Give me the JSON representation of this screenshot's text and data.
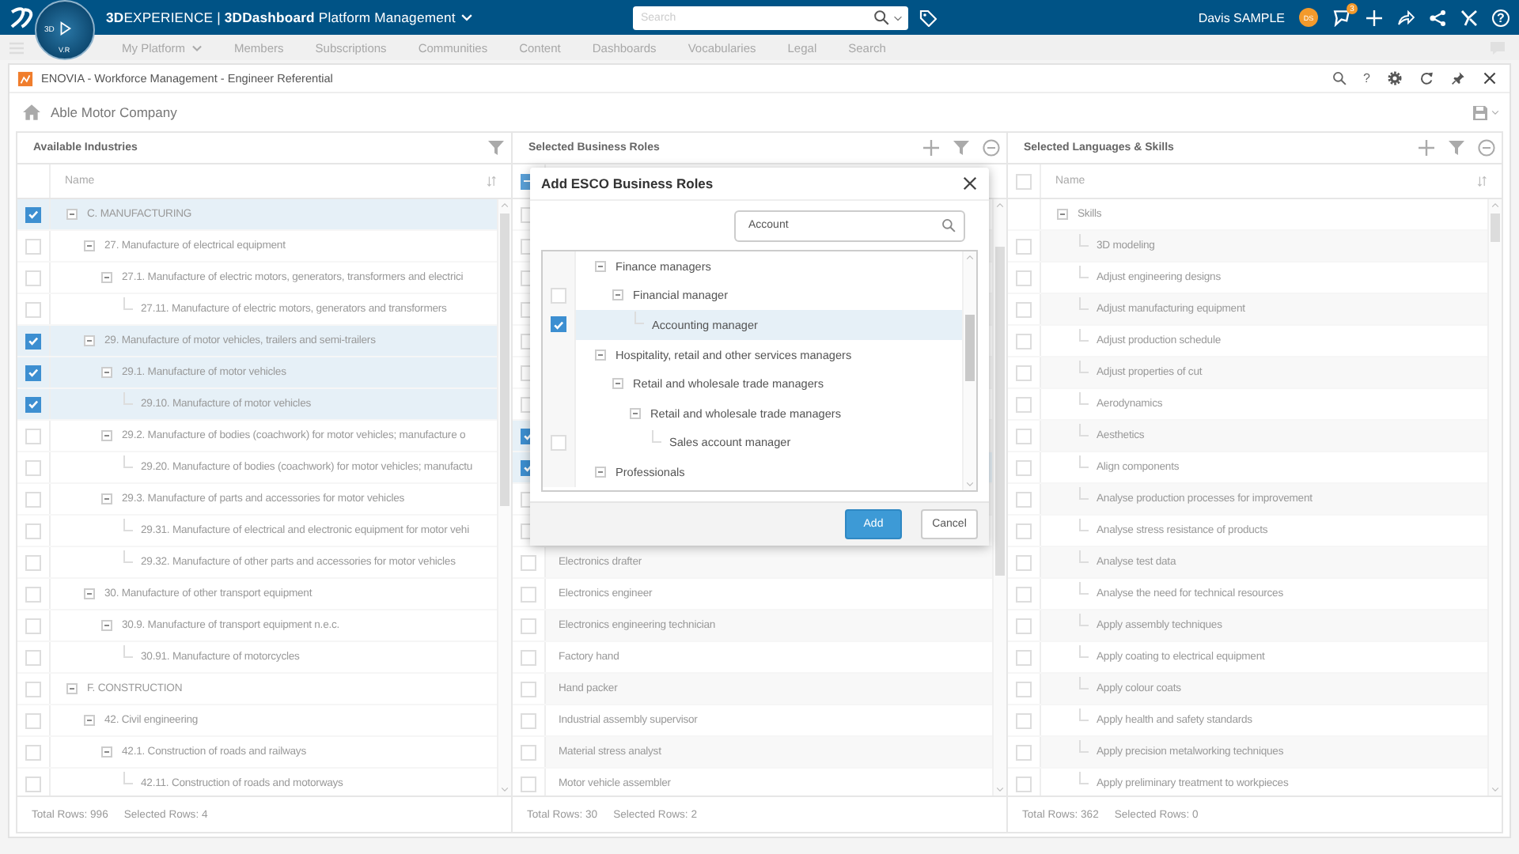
{
  "topbar": {
    "title": "**3D**EXPERIENCE | **3DDashboard** Platform Management",
    "compass_labels": [
      "3D",
      "V.R"
    ],
    "search": {
      "placeholder": "Search"
    },
    "user": "Davis SAMPLE",
    "avatar": "DS",
    "notifications": "3",
    "help_label": "?"
  },
  "dashboard_tabs": [
    {
      "label": "My Platform",
      "dropdown": true
    },
    {
      "label": "Members"
    },
    {
      "label": "Subscriptions"
    },
    {
      "label": "Communities"
    },
    {
      "label": "Content"
    },
    {
      "label": "Dashboards"
    },
    {
      "label": "Vocabularies"
    },
    {
      "label": "Legal"
    },
    {
      "label": "Search"
    }
  ],
  "widget": {
    "title": "ENOVIA - Workforce Management - Engineer Referential",
    "help_label": "?",
    "company": "Able Motor Company"
  },
  "panels": [
    {
      "title": "Available Industries",
      "tools": [
        {
          "kind": "filter"
        }
      ],
      "column": "Name",
      "rows": [
        {
          "name": "C. MANUFACTURING",
          "checked": true,
          "expanded": true,
          "children": [
            {
              "name": "27. Manufacture of electrical equipment",
              "checked": false,
              "expanded": true,
              "children": [
                {
                  "name": "27.1. Manufacture of electric motors, generators, transformers and electrici",
                  "checked": false,
                  "expanded": true,
                  "children": [
                    {
                      "name": "27.11. Manufacture of electric motors, generators and transformers",
                      "checked": false
                    }
                  ]
                }
              ]
            },
            {
              "name": "29. Manufacture of motor vehicles, trailers and semi-trailers",
              "checked": true,
              "expanded": true,
              "children": [
                {
                  "name": "29.1. Manufacture of motor vehicles",
                  "checked": true,
                  "expanded": true,
                  "children": [
                    {
                      "name": "29.10. Manufacture of motor vehicles",
                      "checked": true
                    }
                  ]
                },
                {
                  "name": "29.2. Manufacture of bodies (coachwork) for motor vehicles; manufacture o",
                  "checked": false,
                  "expanded": true,
                  "children": [
                    {
                      "name": "29.20. Manufacture of bodies (coachwork) for motor vehicles; manufactu",
                      "checked": false
                    }
                  ]
                },
                {
                  "name": "29.3. Manufacture of parts and accessories for motor vehicles",
                  "checked": false,
                  "expanded": true,
                  "children": [
                    {
                      "name": "29.31. Manufacture of electrical and electronic equipment for motor vehi",
                      "checked": false
                    },
                    {
                      "name": "29.32. Manufacture of other parts and accessories for motor vehicles",
                      "checked": false
                    }
                  ]
                }
              ]
            },
            {
              "name": "30. Manufacture of other transport equipment",
              "checked": false,
              "expanded": true,
              "children": [
                {
                  "name": "30.9. Manufacture of transport equipment n.e.c.",
                  "checked": false,
                  "expanded": true,
                  "children": [
                    {
                      "name": "30.91. Manufacture of motorcycles",
                      "checked": false
                    }
                  ]
                }
              ]
            }
          ]
        },
        {
          "name": "F. CONSTRUCTION",
          "checked": false,
          "expanded": true,
          "children": [
            {
              "name": "42. Civil engineering",
              "checked": false,
              "expanded": true,
              "children": [
                {
                  "name": "42.1. Construction of roads and railways",
                  "checked": false,
                  "expanded": true,
                  "children": [
                    {
                      "name": "42.11. Construction of roads and motorways",
                      "checked": false
                    }
                  ]
                }
              ]
            }
          ]
        }
      ],
      "total": "Total Rows: 996",
      "selected": "Selected Rows: 4"
    },
    {
      "title": "Selected Business Roles",
      "tools": [
        {
          "kind": "add"
        },
        {
          "kind": "filter"
        },
        {
          "kind": "remove"
        }
      ],
      "header_checkbox": {
        "indeterminate": true
      },
      "striped": true,
      "rows": [
        {
          "checked": false
        },
        {
          "checked": false
        },
        {
          "checked": false
        },
        {
          "checked": false
        },
        {
          "checked": false
        },
        {
          "checked": false
        },
        {
          "checked": false
        },
        {
          "checked": true
        },
        {
          "checked": true
        },
        {
          "checked": false
        },
        {
          "checked": false
        },
        {
          "name": "Electronics drafter",
          "checked": false
        },
        {
          "name": "Electronics engineer",
          "checked": false
        },
        {
          "name": "Electronics engineering technician",
          "checked": false
        },
        {
          "name": "Factory hand",
          "checked": false
        },
        {
          "name": "Hand packer",
          "checked": false
        },
        {
          "name": "Industrial assembly supervisor",
          "checked": false
        },
        {
          "name": "Material stress analyst",
          "checked": false
        },
        {
          "name": "Motor vehicle assembler",
          "checked": false
        }
      ],
      "total": "Total Rows: 30",
      "selected": "Selected Rows: 2"
    },
    {
      "title": "Selected Languages & Skills",
      "tools": [
        {
          "kind": "add"
        },
        {
          "kind": "filter"
        },
        {
          "kind": "remove"
        }
      ],
      "header_checkbox": {
        "checked": false
      },
      "column": "Name",
      "striped": true,
      "rows": [
        {
          "name": "Skills",
          "expanded": true,
          "children": [
            {
              "name": "3D modeling",
              "checked": false
            },
            {
              "name": "Adjust engineering designs",
              "checked": false
            },
            {
              "name": "Adjust manufacturing equipment",
              "checked": false
            },
            {
              "name": "Adjust production schedule",
              "checked": false
            },
            {
              "name": "Adjust properties of cut",
              "checked": false
            },
            {
              "name": "Aerodynamics",
              "checked": false
            },
            {
              "name": "Aesthetics",
              "checked": false
            },
            {
              "name": "Align components",
              "checked": false
            },
            {
              "name": "Analyse production processes for improvement",
              "checked": false
            },
            {
              "name": "Analyse stress resistance of products",
              "checked": false
            },
            {
              "name": "Analyse test data",
              "checked": false
            },
            {
              "name": "Analyse the need for technical resources",
              "checked": false
            },
            {
              "name": "Apply assembly techniques",
              "checked": false
            },
            {
              "name": "Apply coating to electrical equipment",
              "checked": false
            },
            {
              "name": "Apply colour coats",
              "checked": false
            },
            {
              "name": "Apply health and safety standards",
              "checked": false
            },
            {
              "name": "Apply precision metalworking techniques",
              "checked": false
            },
            {
              "name": "Apply preliminary treatment to workpieces",
              "checked": false
            }
          ]
        }
      ],
      "total": "Total Rows: 362",
      "selected": "Selected Rows: 0"
    }
  ],
  "dialog": {
    "title": "Add ESCO Business Roles",
    "search": {
      "value": "Account"
    },
    "rows": [
      {
        "name": "Finance managers",
        "expanded": true,
        "children": [
          {
            "name": "Financial manager",
            "checked": false,
            "expanded": true,
            "children": [
              {
                "name": "Accounting manager",
                "checked": true
              }
            ]
          }
        ]
      },
      {
        "name": "Hospitality, retail and other services managers",
        "expanded": true,
        "children": [
          {
            "name": "Retail and wholesale trade managers",
            "expanded": true,
            "children": [
              {
                "name": "Retail and wholesale trade managers",
                "expanded": true,
                "children": [
                  {
                    "name": "Sales account manager",
                    "checked": false
                  }
                ]
              }
            ]
          }
        ]
      },
      {
        "name": "Professionals",
        "expanded": true
      }
    ],
    "buttons": [
      {
        "label": "Add",
        "kind": "primary"
      },
      {
        "label": "Cancel",
        "kind": "secondary"
      }
    ]
  }
}
